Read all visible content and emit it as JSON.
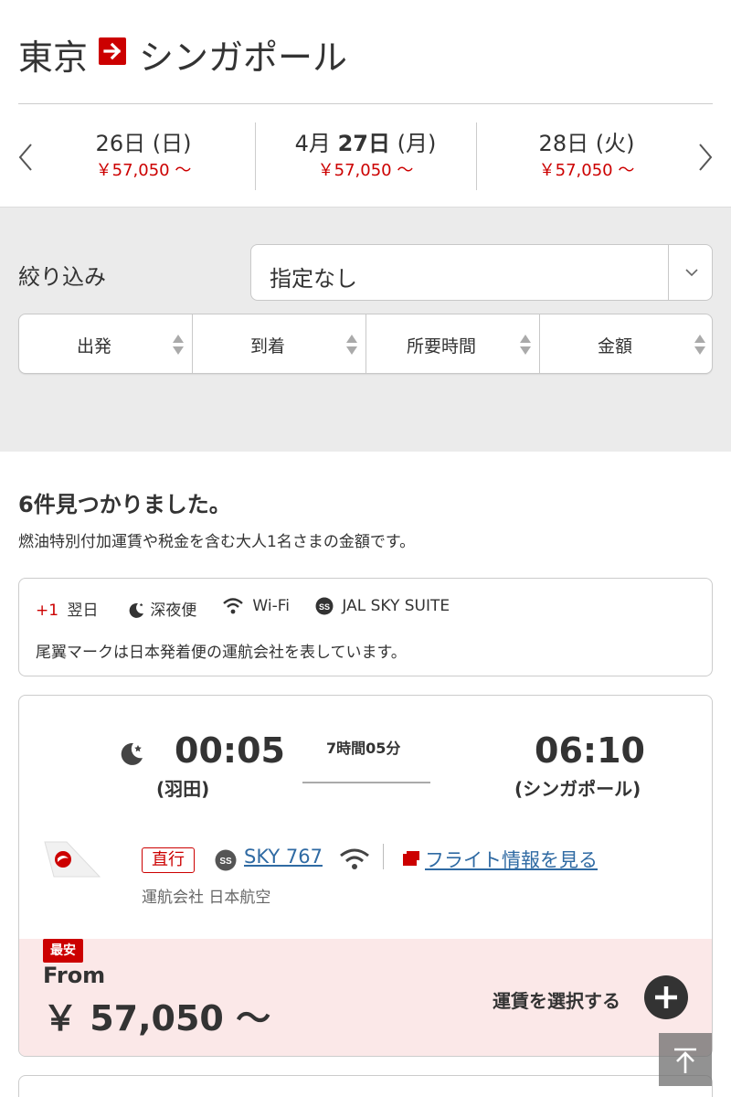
{
  "route": {
    "from": "東京",
    "to": "シンガポール"
  },
  "dates": [
    {
      "label": "26日 (日)",
      "price": "￥57,050 〜"
    },
    {
      "month": "4月",
      "day": "27日",
      "weekday": " (月)",
      "price": "￥57,050 〜"
    },
    {
      "label": "28日 (火)",
      "price": "￥57,050 〜"
    }
  ],
  "filter": {
    "label": "絞り込み",
    "value": "指定なし"
  },
  "sort": [
    "出発",
    "到着",
    "所要時間",
    "金額"
  ],
  "results": {
    "count": "6件見つかりました。",
    "note": "燃油特別付加運賃や税金を含む大人1名さまの金額です。"
  },
  "legend": {
    "next_day_mark": "+1",
    "next_day": "翌日",
    "late_night": "深夜便",
    "wifi": "Wi-Fi",
    "suite": "JAL SKY SUITE",
    "note": "尾翼マークは日本発着便の運航会社を表しています。"
  },
  "flight": {
    "dep_time": "00:05",
    "dep_airport": "(羽田)",
    "duration": "7時間05分",
    "arr_time": "06:10",
    "arr_airport": "(シンガポール)",
    "nonstop": "直行",
    "aircraft": "SKY 767",
    "info_link": "フライト情報を見る",
    "operator": "運航会社 日本航空",
    "cheapest": "最安",
    "from": "From",
    "price": "￥ 57,050 〜",
    "select": "運賃を選択する"
  },
  "colors": {
    "accent": "#cc0000",
    "link": "#2f6aa3",
    "price_bg": "#fbe8e8"
  }
}
